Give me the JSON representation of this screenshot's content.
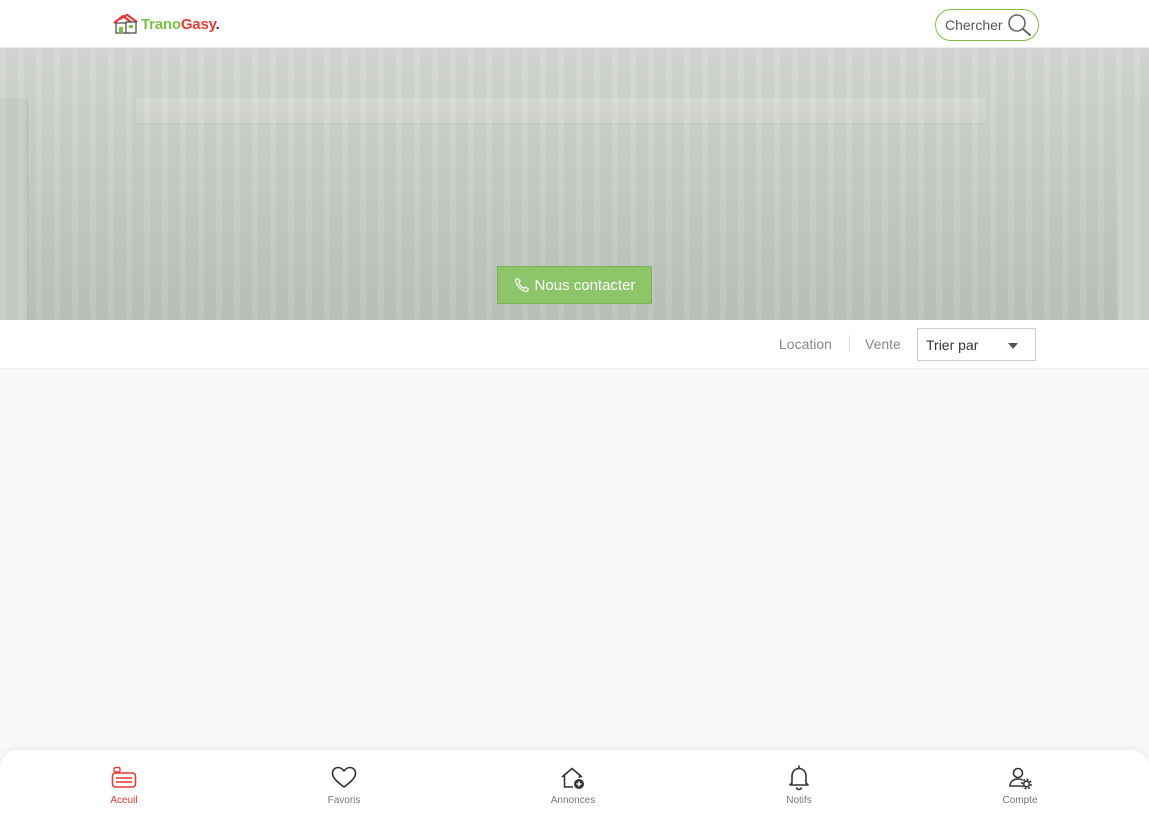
{
  "brand": {
    "name_part1": "Trano",
    "name_part2": "Gasy",
    "name_part3": ".",
    "colors": {
      "green": "#7cc242",
      "red": "#e53935"
    }
  },
  "header": {
    "search_label": "Chercher",
    "search_icon": "search-icon"
  },
  "hero": {
    "contact_label": "Nous contacter",
    "contact_icon": "phone-icon"
  },
  "filters": {
    "location_label": "Location",
    "sale_label": "Vente",
    "sort": {
      "selected": "Trier par"
    }
  },
  "bottom_nav": {
    "items": [
      {
        "label": "Aceuil",
        "icon": "home-listing-icon",
        "active": true
      },
      {
        "label": "Favoris",
        "icon": "heart-icon",
        "active": false
      },
      {
        "label": "Annonces",
        "icon": "house-add-icon",
        "active": false
      },
      {
        "label": "Notifs",
        "icon": "bell-icon",
        "active": false
      },
      {
        "label": "Compte",
        "icon": "user-settings-icon",
        "active": false
      }
    ]
  }
}
